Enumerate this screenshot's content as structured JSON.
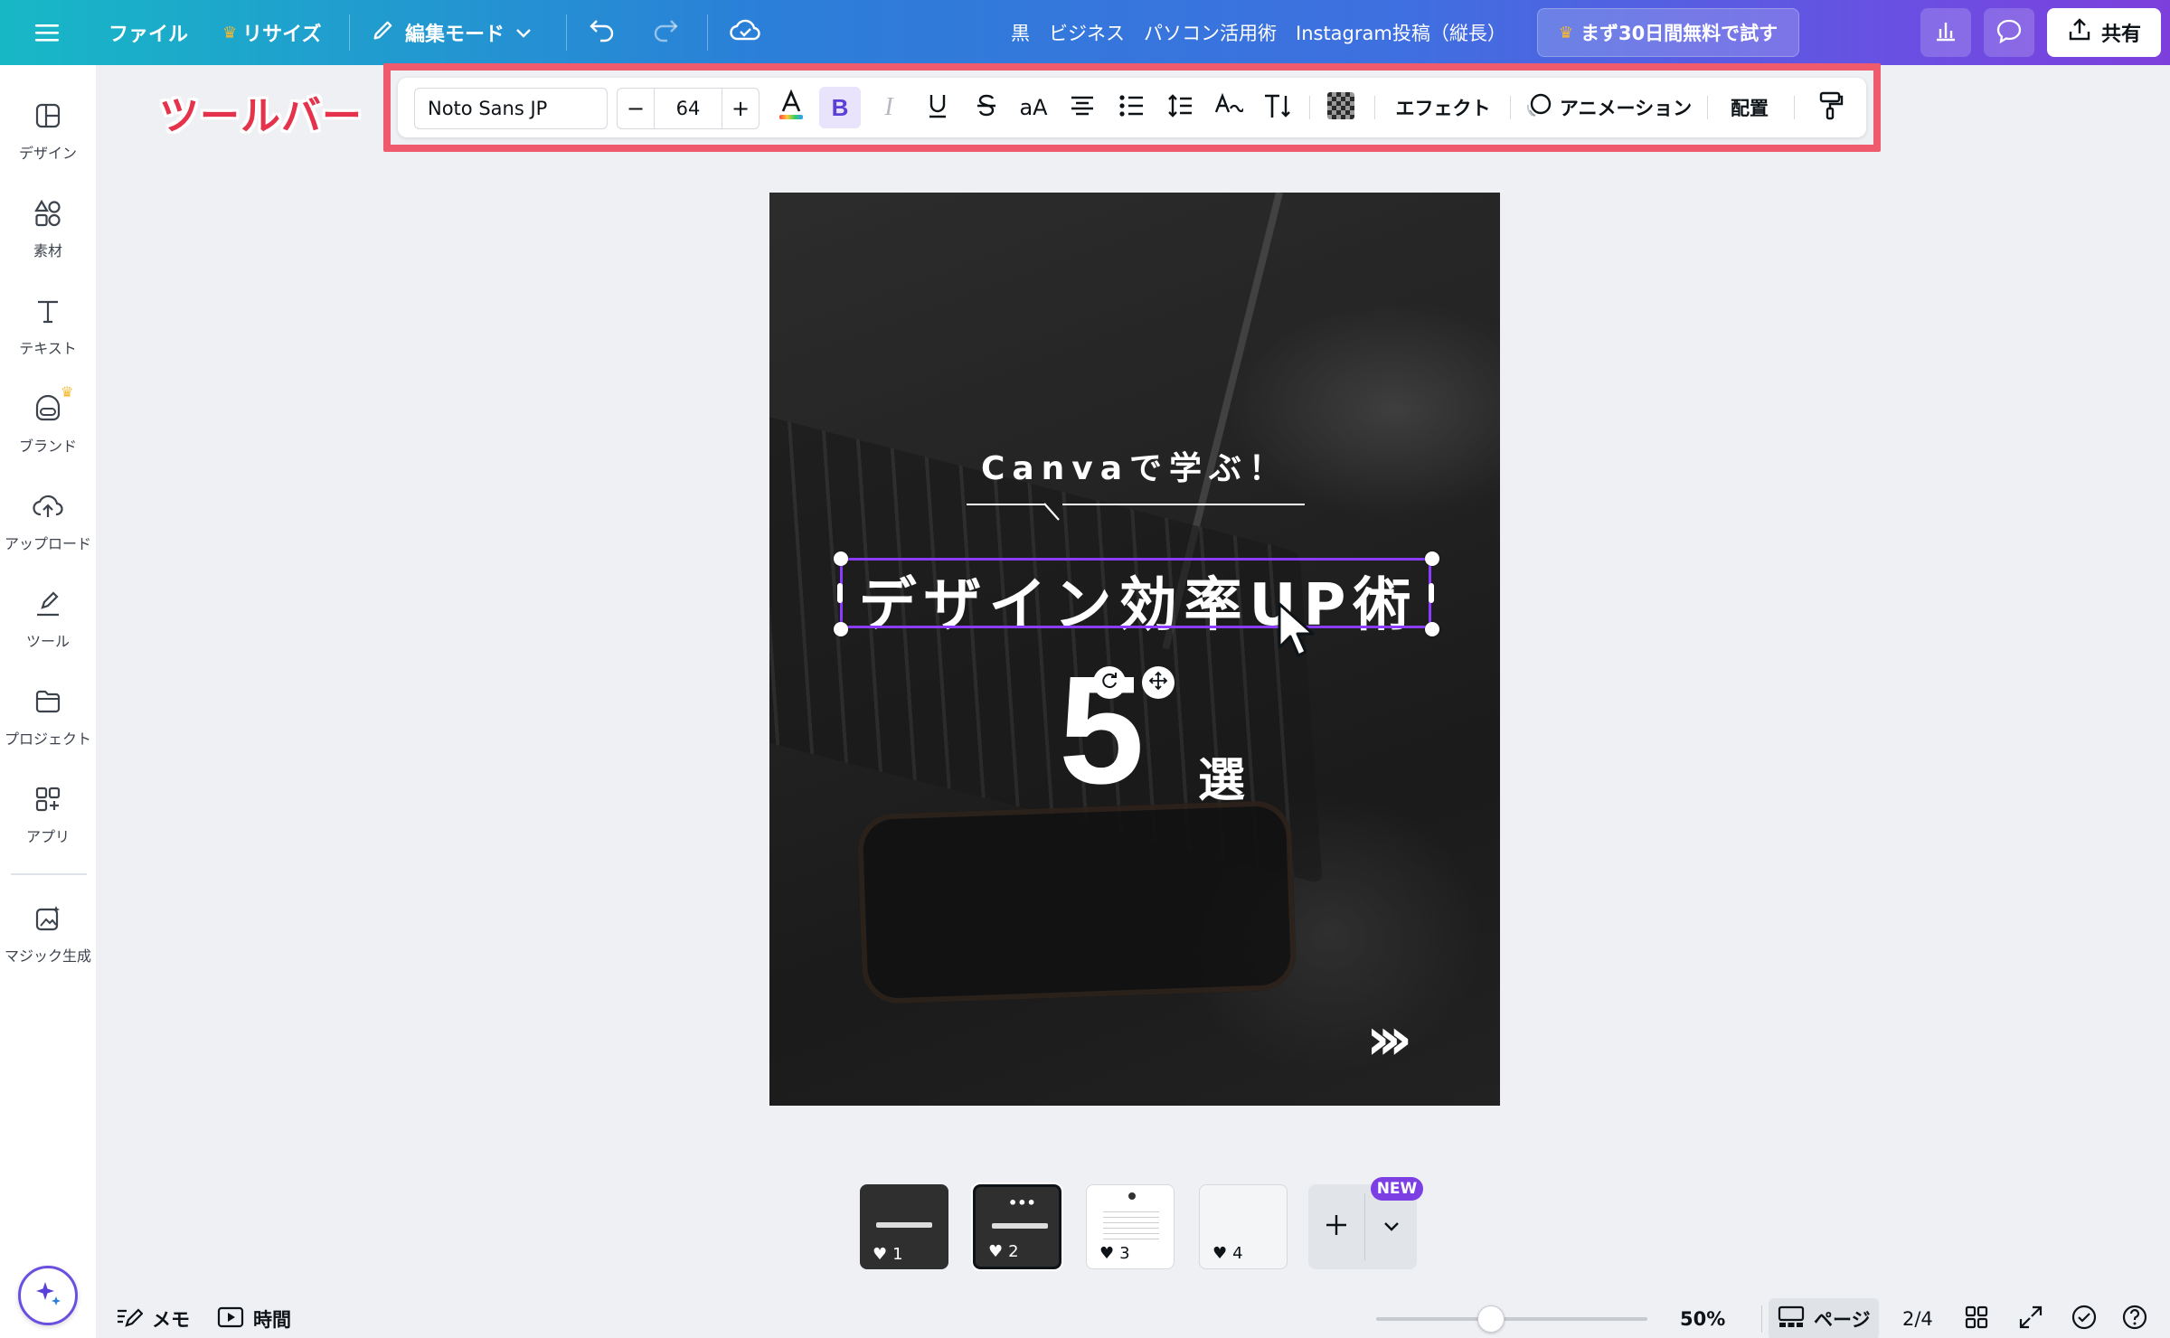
{
  "header": {
    "menu_icon": "hamburger-icon",
    "file": "ファイル",
    "resize": "リサイズ",
    "edit_mode": "編集モード",
    "doc_title": "黒　ビジネス　パソコン活用術　Instagram投稿（縦長）",
    "trial": "まず30日間無料で試す",
    "share": "共有",
    "brand_crown_color": "#f5b931"
  },
  "sidebar": {
    "items": [
      {
        "label": "デザイン",
        "icon": "layout-icon"
      },
      {
        "label": "素材",
        "icon": "elements-icon"
      },
      {
        "label": "テキスト",
        "icon": "text-icon"
      },
      {
        "label": "ブランド",
        "icon": "brand-icon"
      },
      {
        "label": "アップロード",
        "icon": "upload-icon"
      },
      {
        "label": "ツール",
        "icon": "draw-icon"
      },
      {
        "label": "プロジェクト",
        "icon": "folder-icon"
      },
      {
        "label": "アプリ",
        "icon": "apps-icon"
      },
      {
        "label": "マジック生成",
        "icon": "magic-media-icon"
      }
    ]
  },
  "annotation": {
    "label": "ツールバー",
    "color": "#ef5a6c"
  },
  "toolbar": {
    "font_name": "Noto Sans JP",
    "font_size": "64",
    "minus": "−",
    "plus": "+",
    "case_label": "aA",
    "effects": "エフェクト",
    "animation": "アニメーション",
    "position": "配置"
  },
  "canvas": {
    "subtitle": "Canvaで学ぶ！",
    "title": "デザイン効率UP術",
    "number": "5",
    "suffix": "選",
    "arrows": "›››",
    "selection_color": "#8b3dff"
  },
  "pages": {
    "thumbnails": [
      {
        "num": "1"
      },
      {
        "num": "2"
      },
      {
        "num": "3"
      },
      {
        "num": "4"
      }
    ],
    "new_badge": "NEW"
  },
  "bottom": {
    "notes": "メモ",
    "timer": "時間",
    "zoom": "50%",
    "pages_label": "ページ",
    "page_count": "2/4",
    "zoom_fraction": 0.5
  }
}
